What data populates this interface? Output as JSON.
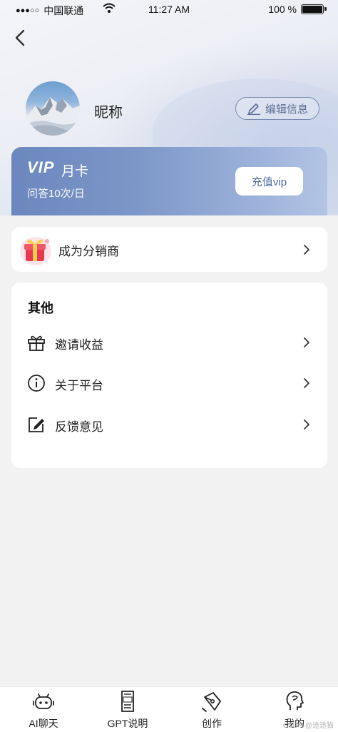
{
  "status_bar": {
    "carrier": "中国联通",
    "signal": "●●●○○",
    "time": "11:27 AM",
    "battery": "100 %"
  },
  "profile": {
    "nickname": "昵称",
    "edit_label": "编辑信息"
  },
  "vip": {
    "logo": "VIP",
    "title": "月卡",
    "subtitle": "问答10次/日",
    "button_label": "充值vip"
  },
  "distributor": {
    "label": "成为分销商"
  },
  "others": {
    "title": "其他",
    "items": [
      {
        "label": "邀请收益",
        "icon": "gift-icon"
      },
      {
        "label": "关于平台",
        "icon": "info-icon"
      },
      {
        "label": "反馈意见",
        "icon": "edit-note-icon"
      }
    ]
  },
  "tabbar": {
    "items": [
      {
        "label": "AI聊天",
        "icon": "robot-icon"
      },
      {
        "label": "GPT说明",
        "icon": "gpt-doc-icon"
      },
      {
        "label": "创作",
        "icon": "pen-nib-icon"
      },
      {
        "label": "我的",
        "icon": "head-profile-icon"
      }
    ]
  },
  "watermark": "CSDN @途途猫",
  "colors": {
    "vip_gradient_start": "#6b87bd",
    "vip_gradient_end": "#b3c4e4",
    "accent": "#5c6d95",
    "page_bg": "#f2f2f2"
  }
}
